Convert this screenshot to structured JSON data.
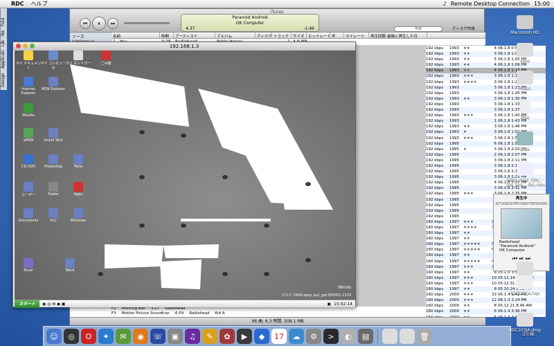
{
  "menubar": {
    "app": "RDC",
    "help": "ヘルプ",
    "app_name": "Remote Desktop Connection",
    "clock": "15:00"
  },
  "left_dock": {
    "items": [
      "Design",
      "Applicati",
      "Lib",
      "Ne",
      "Fold"
    ]
  },
  "itunes": {
    "title": "iTunes",
    "lcd": {
      "track": "Paranoid Android",
      "artist": "OK Computer",
      "elapsed": "4:37",
      "remaining": "-1:46"
    },
    "search_placeholder": "検索",
    "search_label": "ディスク作成",
    "source_header": "ソース",
    "columns": [
      "名前",
      "時間",
      "アーティスト",
      "アルバム",
      "ディスク",
      "トラック",
      "サイズ",
      "ビットレート",
      "年",
      "マイレート",
      "再生回数",
      "最後に再生した日"
    ],
    "source_item": "Jamiroquai",
    "first_row": {
      "num": "1",
      "name": "You",
      "time": "3:28",
      "artist": "Radiohead",
      "album": "Pablo Honey",
      "track": "1",
      "size": "4.9 MB"
    },
    "rows": [
      [
        "192 kbps",
        "1993",
        "★★",
        "4",
        "06.1.8 0:51 PM"
      ],
      [
        "192 kbps",
        "1993",
        "★★",
        "3",
        "06.1.8 1:02 PM"
      ],
      [
        "192 kbps",
        "1993",
        "★★",
        "5",
        "06.1.8 1:05 PM"
      ],
      [
        "192 kbps",
        "1993",
        "★★",
        "4",
        "06.1.8 1:09 PM"
      ],
      [
        "192 kbps",
        "1993",
        "★★",
        "4",
        "06.1.8 1:13 PM"
      ],
      [
        "192 kbps",
        "1993",
        "★★★",
        "3",
        "06.1.8 1:17 PM"
      ],
      [
        "192 kbps",
        "1993",
        "★★★★",
        "3",
        "06.1.8 1:20 PM"
      ],
      [
        "192 kbps",
        "1993",
        "",
        "3",
        "06.1.8 1:23 PM"
      ],
      [
        "192 kbps",
        "1993",
        "",
        "3",
        "06.1.8 1:26 PM"
      ],
      [
        "192 kbps",
        "1993",
        "★★",
        "3",
        "06.1.8 1:30 PM"
      ],
      [
        "192 kbps",
        "1993",
        "",
        "3",
        "06.1.8 1:33 PM"
      ],
      [
        "192 kbps",
        "1993",
        "",
        "3",
        "06.1.8 1:37 PM"
      ],
      [
        "192 kbps",
        "1993",
        "★★★",
        "3",
        "06.1.8 1:40 PM"
      ],
      [
        "192 kbps",
        "1993",
        "",
        "1",
        "06.1.8 1:43 PM"
      ],
      [
        "192 kbps",
        "1993",
        "★★",
        "3",
        "06.1.8 1:46 PM"
      ],
      [
        "192 kbps",
        "1993",
        "★",
        "3",
        "06.1.8 1:51 PM"
      ],
      [
        "192 kbps",
        "1993",
        "★★★",
        "3",
        "06.1.8 1:54 PM"
      ],
      [
        "192 kbps",
        "1995",
        "",
        "6",
        "06.1.8 1:58 PM"
      ],
      [
        "192 kbps",
        "1995",
        "★",
        "3",
        "06.1.8 2:02 PM"
      ],
      [
        "192 kbps",
        "1995",
        "",
        "2",
        "06.1.8 2:07 PM"
      ],
      [
        "192 kbps",
        "1995",
        "",
        "3",
        "06.1.8 2:11 PM"
      ],
      [
        "192 kbps",
        "1995",
        "",
        "3",
        "06.1.8 2:15 PM"
      ],
      [
        "192 kbps",
        "1995",
        "",
        "3",
        "06.1.8 2:19 PM"
      ],
      [
        "192 kbps",
        "1995",
        "",
        "3",
        "06.1.8 2:23 PM"
      ],
      [
        "192 kbps",
        "1995",
        "",
        "4",
        "06.1.8 2:27 PM"
      ],
      [
        "192 kbps",
        "1995",
        "",
        "3",
        "06.1.8 2:31 PM"
      ],
      [
        "192 kbps",
        "1995",
        "★★★",
        "3",
        "06.1.8 2:35 PM"
      ],
      [
        "192 kbps",
        "1995",
        "",
        "2",
        "06.1.8 2:39 PM"
      ],
      [
        "192 kbps",
        "1995",
        "",
        "4",
        "06.1.8 2:43 PM"
      ],
      [
        "192 kbps",
        "1995",
        "",
        "3",
        "06.1.8 2:48 PM"
      ],
      [
        "192 kbps",
        "1995",
        "",
        "3",
        "06.1.8 2:51 PM"
      ],
      [
        "160 kbps",
        "1997",
        "★★★",
        "11",
        "06.1.8 2:55 PM"
      ],
      [
        "160 kbps",
        "1997",
        "★★★★",
        "34",
        "06.1.4 1:25 PM"
      ],
      [
        "160 kbps",
        "1997",
        "★★",
        "5",
        "05.10.24 10:26 PM"
      ],
      [
        "160 kbps",
        "1997",
        "★★",
        "9",
        "05.11.6 6:50 PM"
      ],
      [
        "160 kbps",
        "1997",
        "★★★★★",
        "58",
        "06.1.4 1:30 PM"
      ],
      [
        "160 kbps",
        "1997",
        "★★★★★",
        "53",
        "06.1.4 1:34 PM"
      ],
      [
        "160 kbps",
        "1997",
        "★★",
        "9",
        "05.12.21 10:53 PM"
      ],
      [
        "160 kbps",
        "1997",
        "★★★★★",
        "46",
        "06.1.4 1:39 PM"
      ],
      [
        "160 kbps",
        "1997",
        "★★★",
        "36",
        "06.1.4 1:50 PM"
      ],
      [
        "160 kbps",
        "1997",
        "★★",
        "8",
        "05.1.5 3:50 PM"
      ],
      [
        "160 kbps",
        "1997",
        "★★★",
        "10",
        "05.11.14 11:45 PM"
      ],
      [
        "160 kbps",
        "1997",
        "★★★",
        "10",
        "05.12.31 2:45 PM"
      ],
      [
        "160 kbps",
        "1997",
        "★★",
        "8",
        "05.10.24 9:08 PM"
      ],
      [
        "160 kbps",
        "2000",
        "★★★",
        "33",
        "06.1.4 1:42 PM"
      ],
      [
        "160 kbps",
        "2000",
        "★★★",
        "12",
        "06.1.3 3:24 PM"
      ],
      [
        "160 kbps",
        "2000",
        "★★",
        "8",
        "05.12.21 8:46 AM"
      ],
      [
        "160 kbps",
        "2000",
        "★★",
        "6",
        "06.1.4 3:36 PM"
      ],
      [
        "160 kbps",
        "2000",
        "★★",
        "5",
        "06.1.3 7:37 AM"
      ],
      [
        "160 kbps",
        "2000",
        "★★",
        "3",
        "06.1.1 9:28 PM"
      ],
      [
        "160 kbps",
        "2000",
        "★★★",
        "7",
        "05.12.3 9:13 PM"
      ],
      [
        "160 kbps",
        "2000",
        "★★★",
        "3",
        "05.11.29 5:06 AM"
      ],
      [
        "160 kbps",
        "2000",
        "★★",
        "4",
        "06.1.1 2:01 PM"
      ]
    ],
    "bottom_rows": [
      {
        "num": "F2",
        "name": "Morning Bell",
        "time": "3:27",
        "artist": "Radiohead"
      },
      {
        "num": "F3",
        "name": "Motion Picture Soundtrac",
        "time": "6:59",
        "artist": "Radiohead",
        "album": "Kid A"
      }
    ],
    "status": "96 曲, 6.3 時間, 508.1 MB"
  },
  "rdc": {
    "title": "192.168.1.3",
    "start": "スタート",
    "build_info": "ビルド 2600.xpsp_sp2_gdr.050301-1519",
    "tray_time": "15:02:14",
    "windows_label": "Windo",
    "xp_icons": [
      "マイ ドキュメント",
      "マイ コンピュータ",
      "マイ ネットワーク",
      "ごみ箱",
      "Internet Explorer",
      "MSN Explorer",
      "Mozilla",
      "aMSN",
      "Install Skin",
      "CD DVD",
      "Photoshop",
      "ToDo",
      "ユーザー",
      "Folder",
      "Apps",
      "Documents",
      "VLC",
      "Windows",
      "Excel",
      "Word"
    ]
  },
  "now_playing": {
    "header": "再生中",
    "sub": "KITUNESSTATUSNOTRESPONS",
    "artist": "Radiohead",
    "track": "\"Paranoid Android\"",
    "album": "OK Computer"
  },
  "desktop_icons": [
    {
      "name": "Macintosh HD"
    },
    {
      "name": "data"
    },
    {
      "name": "music"
    },
    {
      "name": "iPod"
    },
    {
      "name": "iDisk"
    },
    {
      "name": "dizzy_mizz_lizzy_-_the_sire....96).mov"
    },
    {
      "name": "picture"
    },
    {
      "name": "RDC103JA.hqx"
    },
    {
      "name": "RDC103JA.dmg"
    },
    {
      "name": "ゴミ箱"
    }
  ],
  "colors": {
    "accent": "#3f73b8",
    "selection": "#b5b5b5"
  }
}
